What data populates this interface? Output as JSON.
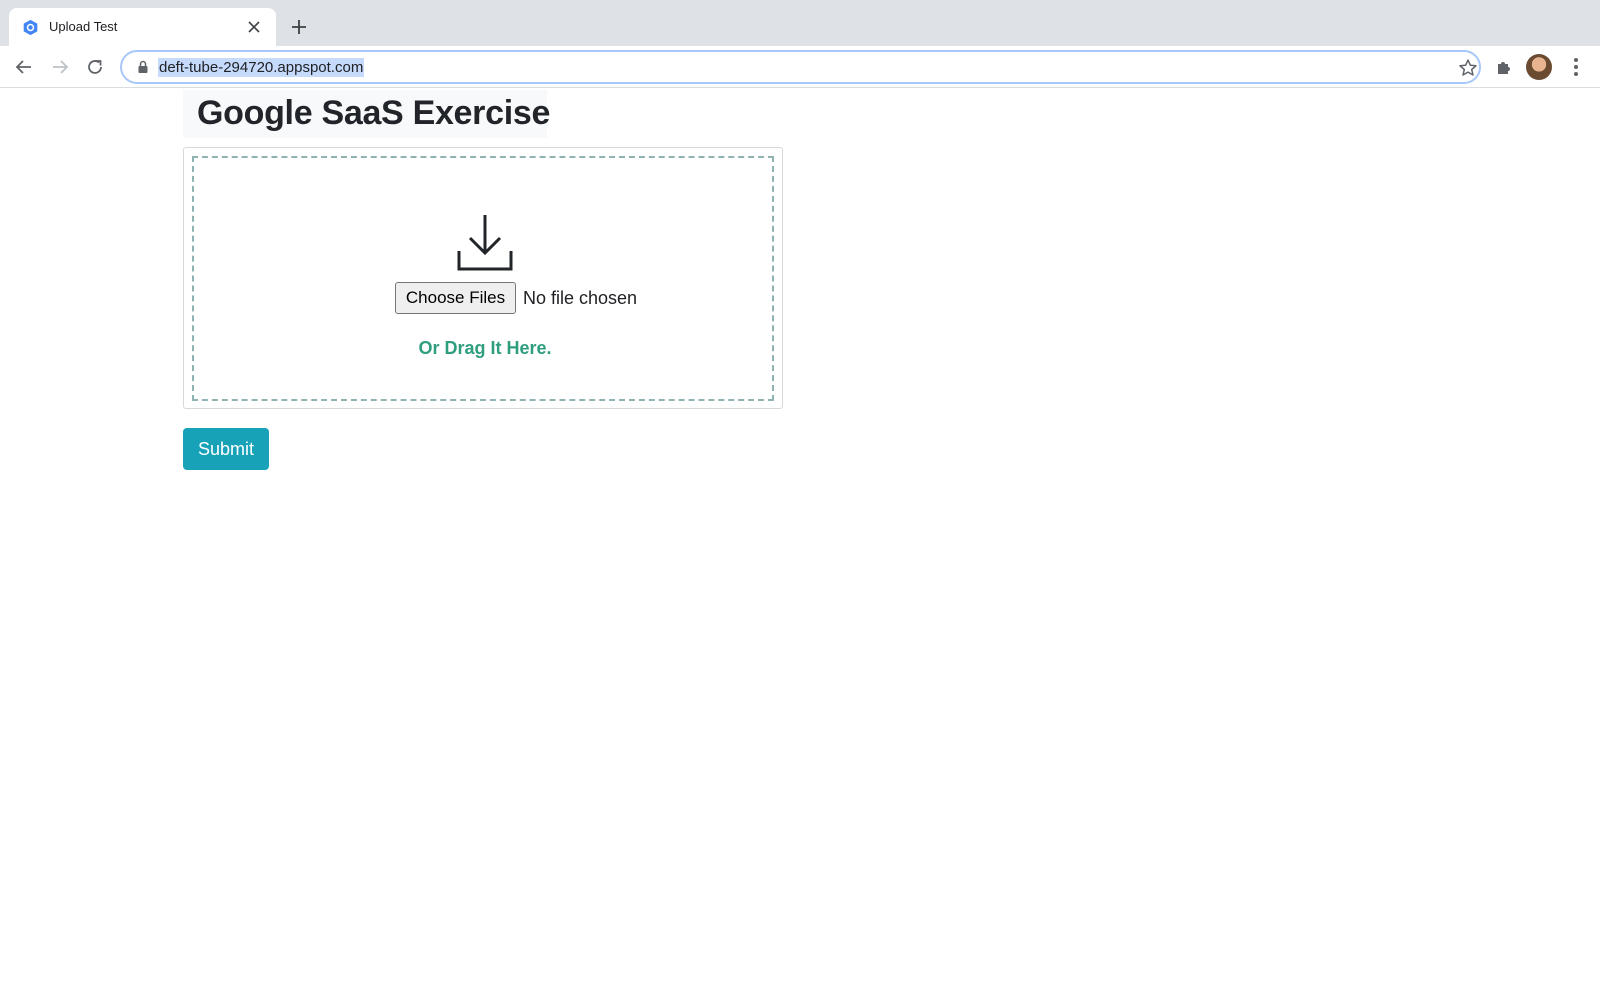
{
  "browser": {
    "tab": {
      "title": "Upload Test",
      "favicon": "gcp-icon"
    },
    "omnibox": {
      "url": "deft-tube-294720.appspot.com"
    },
    "icons": [
      "back-icon",
      "forward-icon",
      "reload-icon",
      "lock-icon",
      "star-icon",
      "extensions-icon",
      "profile-avatar",
      "menu-icon",
      "close-icon",
      "plus-icon"
    ]
  },
  "page": {
    "heading": "Google SaaS Exercise",
    "upload": {
      "icon": "download-icon",
      "choose_label": "Choose Files",
      "file_status": "No file chosen",
      "drag_text": "Or Drag It Here."
    },
    "submit_label": "Submit"
  },
  "colors": {
    "tabbar": "#dee1e6",
    "submit": "#17a2b8",
    "drag_text": "#2f9e7f",
    "dashed_border": "#8fb3b3",
    "url_highlight": "#c6dbfc"
  }
}
